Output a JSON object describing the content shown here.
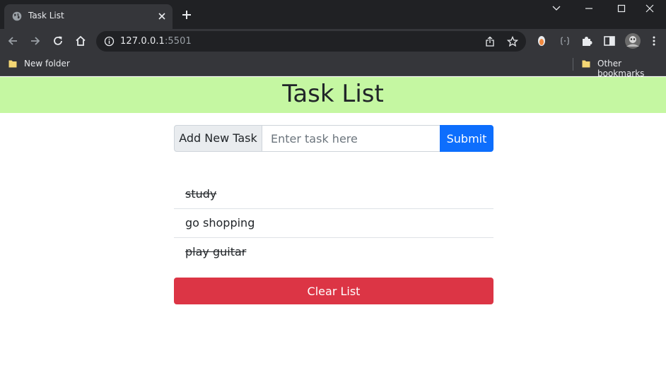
{
  "browser": {
    "tab": {
      "title": "Task List"
    },
    "url": {
      "host": "127.0.0.1",
      "port": ":5501"
    },
    "bookmarks": [
      {
        "label": "New folder"
      },
      {
        "label": "Other bookmarks"
      }
    ]
  },
  "app": {
    "title": "Task List",
    "form": {
      "label": "Add New Task",
      "input_placeholder": "Enter task here",
      "input_value": "",
      "submit_label": "Submit"
    },
    "tasks": [
      {
        "text": "study",
        "completed": true
      },
      {
        "text": "go shopping",
        "completed": false
      },
      {
        "text": "play guitar",
        "completed": true
      }
    ],
    "clear_label": "Clear List"
  },
  "colors": {
    "header_bg": "#c5f7a2",
    "submit_bg": "#0d6efd",
    "clear_bg": "#dc3545"
  }
}
